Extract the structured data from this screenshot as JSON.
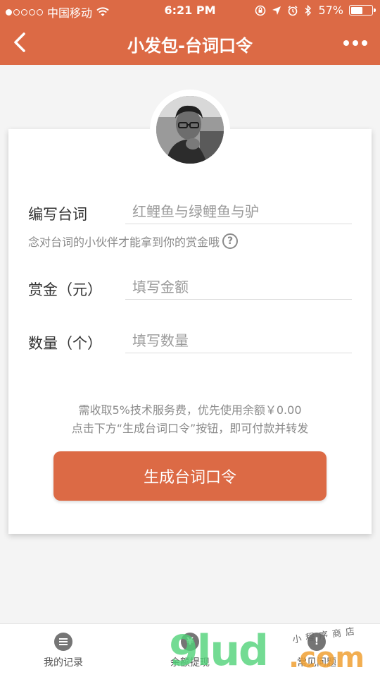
{
  "status_bar": {
    "carrier": "中国移动",
    "time": "6:21 PM",
    "battery_text": "57%",
    "battery_level": 0.57,
    "signal_bars_filled": 1,
    "signal_bars_total": 5
  },
  "nav": {
    "title": "小发包-台词口令",
    "back_icon": "chevron-left-icon",
    "more_icon": "more-dots-icon"
  },
  "form": {
    "password_label": "编写台词",
    "password_placeholder": "红鲤鱼与绿鲤鱼与驴",
    "hint": "念对台词的小伙伴才能拿到你的赏金哦",
    "amount_label": "赏金（元）",
    "amount_placeholder": "填写金额",
    "count_label": "数量（个）",
    "count_placeholder": "填写数量"
  },
  "notes": {
    "line1": "需收取5%技术服务费，优先使用余额￥0.00",
    "line2": "点击下方“生成台词口令”按钮，即可付款并转发"
  },
  "submit_label": "生成台词口令",
  "tabs": [
    {
      "label": "我的记录",
      "icon": "list-icon"
    },
    {
      "label": "余额提现",
      "icon": "yuan-icon"
    },
    {
      "label": "常见问题",
      "icon": "exclamation-icon"
    }
  ],
  "watermark": {
    "main": "9lud",
    "suffix": ".com",
    "small": "小程序商店"
  },
  "colors": {
    "accent": "#dc6a45",
    "background": "#f4f4f4",
    "card": "#ffffff",
    "muted_text": "#8a8a8a"
  }
}
